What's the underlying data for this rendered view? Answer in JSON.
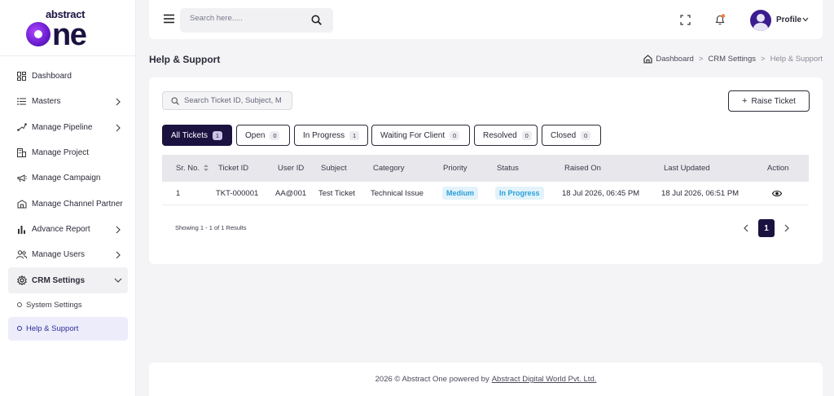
{
  "brand": {
    "logo_small": "abstract",
    "logo_big": "ne"
  },
  "sidebar": {
    "items": [
      {
        "label": "Dashboard",
        "icon": "dashboard-icon"
      },
      {
        "label": "Masters",
        "icon": "list-icon"
      },
      {
        "label": "Manage Pipeline",
        "icon": "pipeline-icon"
      },
      {
        "label": "Manage Project",
        "icon": "building-icon"
      },
      {
        "label": "Manage Campaign",
        "icon": "megaphone-icon"
      },
      {
        "label": "Manage Channel Partner",
        "icon": "partner-icon"
      },
      {
        "label": "Advance Report",
        "icon": "chart-icon"
      },
      {
        "label": "Manage Users",
        "icon": "users-icon"
      },
      {
        "label": "CRM Settings",
        "icon": "gear-icon"
      }
    ],
    "subitems": [
      {
        "label": "System Settings"
      },
      {
        "label": "Help & Support"
      }
    ]
  },
  "header": {
    "search_placeholder": "Search here.....",
    "profile_label": "Profile"
  },
  "page": {
    "title": "Help & Support",
    "breadcrumb": [
      "Dashboard",
      "CRM Settings",
      "Help & Support"
    ],
    "breadcrumb_sep": ">"
  },
  "toolbar": {
    "search_placeholder": "Search Ticket ID, Subject, M",
    "raise_label": "Raise Ticket",
    "raise_plus": "+"
  },
  "tabs": [
    {
      "label": "All Tickets",
      "count": "1",
      "active": true
    },
    {
      "label": "Open",
      "count": "0"
    },
    {
      "label": "In Progress",
      "count": "1"
    },
    {
      "label": "Waiting For Client",
      "count": "0"
    },
    {
      "label": "Resolved",
      "count": "0"
    },
    {
      "label": "Closed",
      "count": "0"
    }
  ],
  "table": {
    "headers": [
      "Sr. No.",
      "Ticket ID",
      "User ID",
      "Subject",
      "Category",
      "Priority",
      "Status",
      "Raised On",
      "Last Updated",
      "Action"
    ],
    "rows": [
      {
        "sr": "1",
        "ticket_id": "TKT-000001",
        "user_id": "AA@001",
        "subject": "Test Ticket",
        "category": "Technical Issue",
        "priority": "Medium",
        "status": "In Progress",
        "raised_on": "18 Jul 2026, 06:45 PM",
        "last_updated": "18 Jul 2026, 06:51 PM"
      }
    ]
  },
  "pagination": {
    "showing": "Showing 1 - 1 of 1 Results",
    "current_page": "1"
  },
  "footer": {
    "text": "2026 © Abstract One powered by",
    "link": "Abstract Digital World Pvt. Ltd."
  },
  "colors": {
    "primary": "#1b1240",
    "accent_blue": "#2b9ed8",
    "notification": "#ff7a2e"
  }
}
